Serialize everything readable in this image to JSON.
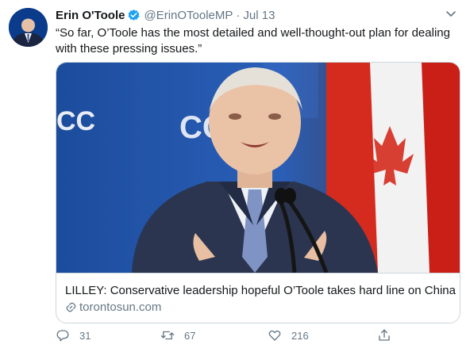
{
  "tweet": {
    "author_name": "Erin O'Toole",
    "handle": "@ErinOTooleMP",
    "separator": "·",
    "date": "Jul 13",
    "text": "“So far, O’Toole has the most detailed and well-thought-out plan for dealing with these pressing issues.”"
  },
  "card": {
    "title": "LILLEY: Conservative leadership hopeful O’Toole takes hard line on China",
    "domain": "torontosun.com",
    "image_sign_text": "CC"
  },
  "actions": {
    "reply_count": "31",
    "retweet_count": "67",
    "like_count": "216"
  },
  "colors": {
    "verified": "#1da1f2",
    "muted": "#657786",
    "border": "#ccd6dd",
    "stage_blue": "#1e4fa8"
  },
  "icons": {
    "verified": "verified-badge-icon",
    "menu": "chevron-down-icon",
    "link": "link-icon",
    "reply": "reply-icon",
    "retweet": "retweet-icon",
    "like": "like-icon",
    "share": "share-icon"
  }
}
